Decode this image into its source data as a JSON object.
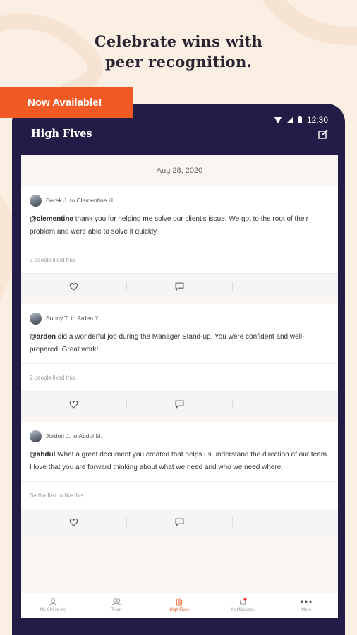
{
  "headline": {
    "line1": "Celebrate wins with",
    "line2": "peer recognition."
  },
  "banner": {
    "label": "Now Available!"
  },
  "status_bar": {
    "time": "12:30"
  },
  "app_bar": {
    "title": "High Fives",
    "compose_icon": "compose-icon"
  },
  "feed": {
    "date": "Aug 28, 2020",
    "posts": [
      {
        "author_line": "Derek J. to Clementine H.",
        "mention": "@clementine",
        "body": " thank you for helping me solve our client's issue. We got to the root of their problem and were able to solve it quickly.",
        "likes": "3 people liked this."
      },
      {
        "author_line": "Sunny T. to Arden Y.",
        "mention": "@arden",
        "body": "  did a wonderful job during the Manager Stand-up. You were confident and well-prepared. Great work!",
        "likes": "2 people liked this."
      },
      {
        "author_line": "Jordon J. to Abdul M.",
        "mention": "@abdul",
        "body": " What a great document you created that helps us understand the direction of our team. I love that you are forward thinking about what we need and who we need where.",
        "likes": "Be the first to like this"
      }
    ]
  },
  "tabs": [
    {
      "label": "My Check-ins",
      "icon": "person-icon"
    },
    {
      "label": "Team",
      "icon": "team-icon"
    },
    {
      "label": "High Fives",
      "icon": "high-five-icon",
      "active": true
    },
    {
      "label": "Notifications",
      "icon": "bell-icon"
    },
    {
      "label": "More",
      "icon": "more-icon"
    }
  ],
  "colors": {
    "accent": "#f15a24",
    "phone_frame": "#231c47",
    "background": "#fbeee2"
  }
}
